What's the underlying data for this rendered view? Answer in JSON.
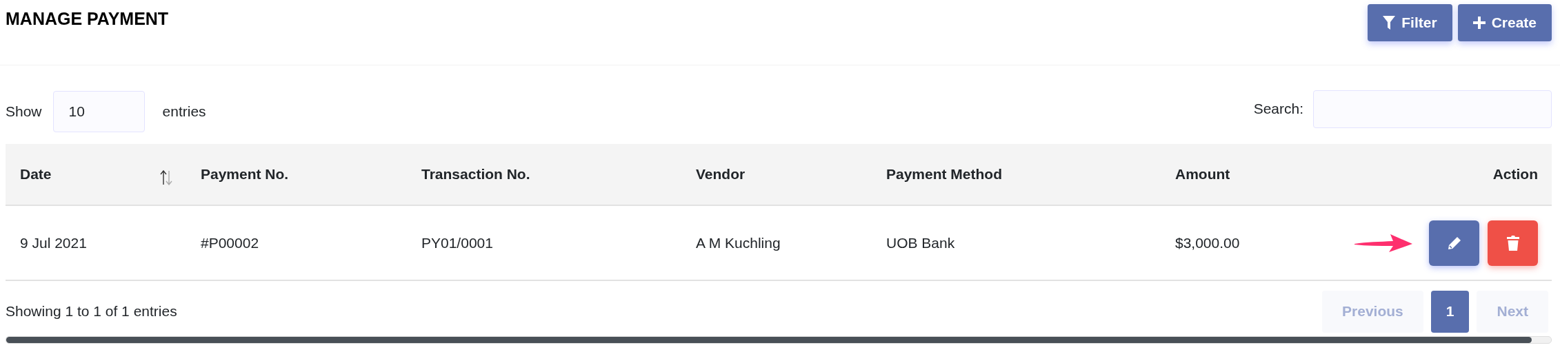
{
  "page": {
    "title": "MANAGE PAYMENT"
  },
  "toolbar": [
    {
      "label": "Filter",
      "kind": "filter"
    },
    {
      "label": "Create",
      "kind": "create"
    }
  ],
  "length_control": {
    "prefix": "Show",
    "value": "10",
    "suffix": "entries"
  },
  "search": {
    "label": "Search:"
  },
  "table": {
    "columns": [
      {
        "label": "Date",
        "sortable": true,
        "kind": "text"
      },
      {
        "label": "Payment No.",
        "sortable": false,
        "kind": "text"
      },
      {
        "label": "Transaction No.",
        "sortable": false,
        "kind": "text"
      },
      {
        "label": "Vendor",
        "sortable": false,
        "kind": "text"
      },
      {
        "label": "Payment Method",
        "sortable": false,
        "kind": "text"
      },
      {
        "label": "Amount",
        "sortable": false,
        "kind": "text"
      },
      {
        "label": "Action",
        "sortable": false,
        "kind": "actions"
      }
    ],
    "rows": [
      {
        "cells": [
          "9 Jul 2021",
          "#P00002",
          "PY01/0001",
          "A M Kuchling",
          "UOB Bank",
          "$3,000.00"
        ],
        "actions": [
          {
            "kind": "edit"
          },
          {
            "kind": "delete"
          }
        ]
      }
    ]
  },
  "footer": {
    "info": "Showing 1 to 1 of 1 entries",
    "pagination": [
      {
        "label": "Previous",
        "kind": "nav",
        "selected": false,
        "disabled": true
      },
      {
        "label": "1",
        "kind": "page",
        "selected": true,
        "disabled": false
      },
      {
        "label": "Next",
        "kind": "nav",
        "selected": false,
        "disabled": true
      }
    ]
  }
}
